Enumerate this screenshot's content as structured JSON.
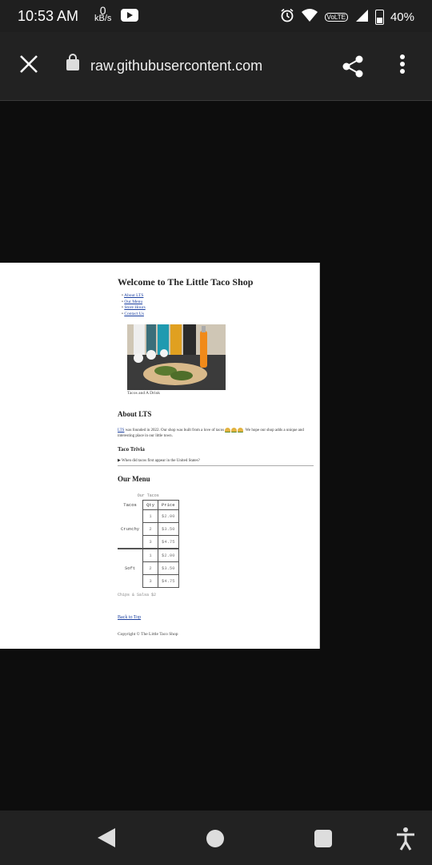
{
  "status_bar": {
    "time": "10:53 AM",
    "net_speed_value": "0",
    "net_speed_unit": "kB/s",
    "signal_label": "VoLTE",
    "battery": "40%"
  },
  "browser": {
    "url": "raw.githubusercontent.com",
    "icons": [
      "close-icon",
      "lock-icon",
      "share-icon",
      "more-icon"
    ]
  },
  "page": {
    "title": "Welcome to The Little Taco Shop",
    "nav": [
      "About LTS",
      "Our Menu",
      "Store Hours",
      "Contact Us"
    ],
    "image_caption": "Tacos and A Drink",
    "about_heading": "About LTS",
    "about_link": "LTS",
    "about_text": " was founded in 2022. Our shop was built from a love of tacos",
    "about_text_2": "We hope our shop adds a unique and interesting place in our little town.",
    "trivia_heading": "Taco Trivia",
    "trivia_question": "When did tacos first appear in the United States?",
    "menu_heading": "Our Menu",
    "table": {
      "caption": "Our Tacos",
      "headers": [
        "Tacos",
        "Qty",
        "Price"
      ],
      "groups": [
        {
          "name": "Crunchy",
          "rows": [
            [
              "1",
              "$2.00"
            ],
            [
              "2",
              "$3.50"
            ],
            [
              "3",
              "$4.75"
            ]
          ]
        },
        {
          "name": "Soft",
          "rows": [
            [
              "1",
              "$2.00"
            ],
            [
              "2",
              "$3.50"
            ],
            [
              "3",
              "$4.75"
            ]
          ]
        }
      ],
      "footnote": "Chips & Salsa $2"
    },
    "back_to_top": "Back to Top",
    "copyright": "Copyright © The Little Taco Shop"
  }
}
